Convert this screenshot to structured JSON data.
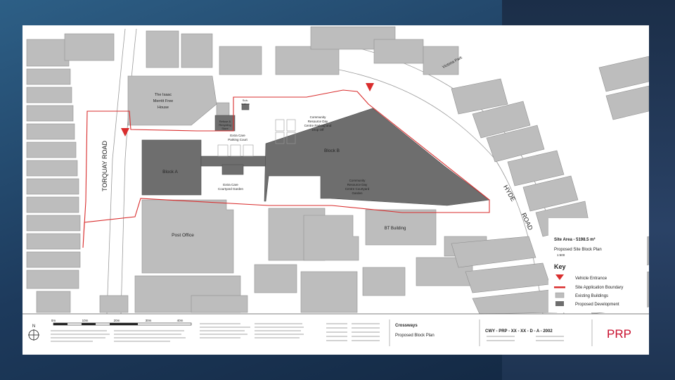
{
  "colors": {
    "existing_building": "#bdbdbd",
    "proposed_development": "#6e6e6e",
    "boundary": "#d92d2d",
    "brand": "#c8102e"
  },
  "streets": {
    "torquay_road": "TORQUAY ROAD",
    "hyde": "HYDE",
    "road": "ROAD",
    "victoria_park": "Victoria Park"
  },
  "labels": {
    "isaac_1": "The Isaac",
    "isaac_2": "Merritt Free",
    "isaac_3": "House",
    "refuse_1": "Refuse &",
    "refuse_2": "Recycling",
    "refuse_3": "Store",
    "substation_1": "Sub-",
    "substation_2": "station",
    "extra_care_parking_1": "Extra Care",
    "extra_care_parking_2": "Parking Court",
    "crdc_parking_1": "Community",
    "crdc_parking_2": "Resource Day",
    "crdc_parking_3": "Centre Parking and",
    "crdc_parking_4": "Drop Off",
    "block_a": "Block A",
    "block_b": "Block B",
    "extra_care_garden_1": "Extra Care",
    "extra_care_garden_2": "Courtyard Garden",
    "crdc_garden_1": "Community",
    "crdc_garden_2": "Resource Day",
    "crdc_garden_3": "Centre Courtyard",
    "crdc_garden_4": "Garden",
    "post_office": "Post Office",
    "bt_building": "BT Building"
  },
  "side": {
    "site_area": "Site Area - 5198.5   m²",
    "plan_title": "Proposed Site Block Plan",
    "scale": "1:500"
  },
  "key": {
    "title": "Key",
    "items": [
      {
        "label": "Vehicle Entrance",
        "type": "triangle"
      },
      {
        "label": "Site Application Boundary",
        "type": "line"
      },
      {
        "label": "Existing Buildings",
        "type": "light-box"
      },
      {
        "label": "Proposed Development",
        "type": "dark-box"
      }
    ]
  },
  "scalebar": {
    "north": "N",
    "ticks": [
      "0m",
      "10m",
      "20m",
      "30m",
      "40m"
    ]
  },
  "title_block": {
    "project": "Crossways",
    "drawing": "Proposed Block Plan",
    "reference": "CWY - PRP - XX - XX - D - A - 2002",
    "brand": "PRP"
  }
}
